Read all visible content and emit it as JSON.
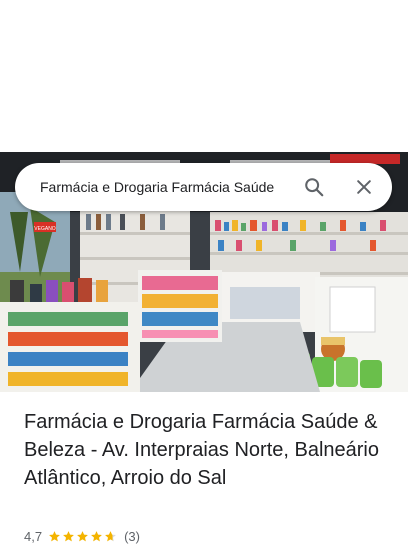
{
  "search": {
    "value": "Farmácia e Drogaria Farmácia Saúde",
    "search_icon": "search-icon",
    "close_icon": "close-icon"
  },
  "place": {
    "title": "Farmácia e Drogaria Farmácia Saúde & Beleza - Av. Interpraias Norte, Balneário Atlântico, Arroio do Sal",
    "rating": "4,7",
    "stars": 4.7,
    "reviews": "(3)",
    "photo_sign": "VEGANO"
  },
  "colors": {
    "star": "#f4b400",
    "star_empty": "#dadce0",
    "icon": "#5f6368",
    "text": "#202124",
    "secondary": "#5f6368"
  }
}
